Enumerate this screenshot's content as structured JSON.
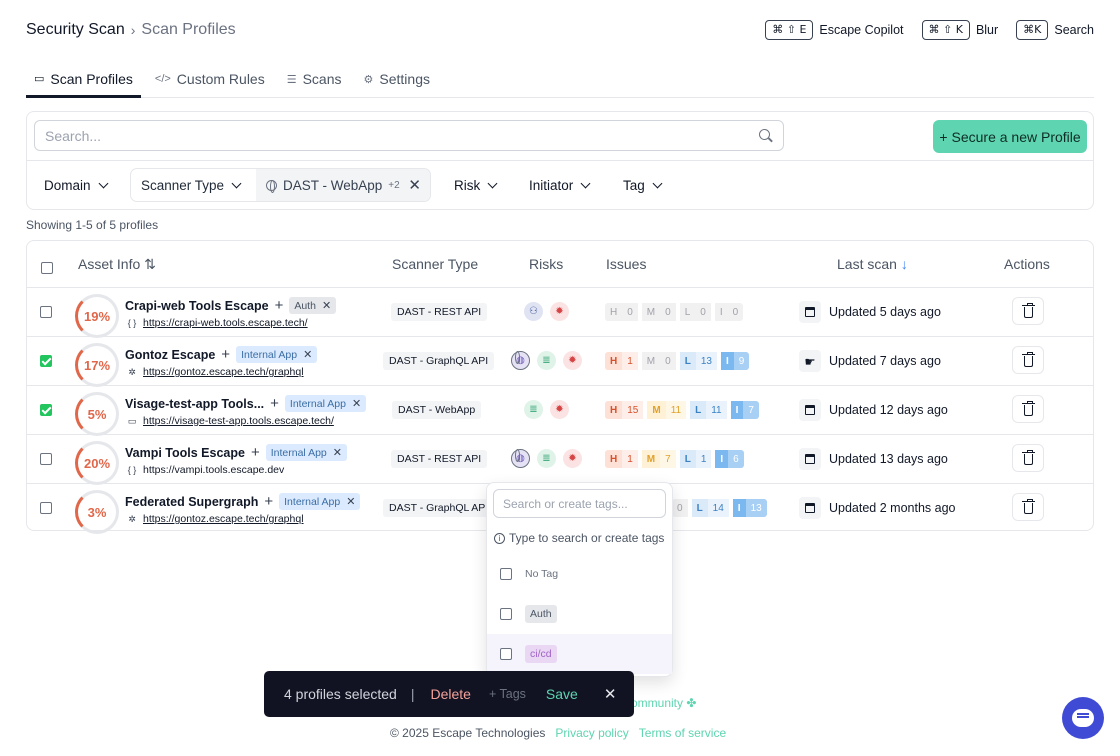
{
  "breadcrumb": {
    "root": "Security Scan",
    "separator": "›",
    "current": "Scan Profiles"
  },
  "shortcuts": [
    {
      "keys": "⌘ ⇧ E",
      "label": "Escape Copilot"
    },
    {
      "keys": "⌘ ⇧ K",
      "label": "Blur"
    },
    {
      "keys": "⌘K",
      "label": "Search"
    }
  ],
  "tabs": [
    {
      "label": "Scan Profiles",
      "icon": "layers-icon",
      "active": true
    },
    {
      "label": "Custom Rules",
      "icon": "code-icon",
      "active": false
    },
    {
      "label": "Scans",
      "icon": "list-icon",
      "active": false
    },
    {
      "label": "Settings",
      "icon": "gear-icon",
      "active": false
    }
  ],
  "search": {
    "placeholder": "Search...",
    "value": ""
  },
  "primary_button": {
    "label": "Secure a new Profile"
  },
  "filters": {
    "domain": "Domain",
    "scanner_type": "Scanner Type",
    "scanner_value": "DAST - WebApp",
    "scanner_more": "+2",
    "risk": "Risk",
    "initiator": "Initiator",
    "tag": "Tag"
  },
  "showing": "Showing 1-5 of 5 profiles",
  "table": {
    "headers": {
      "asset": "Asset Info",
      "scanner": "Scanner Type",
      "risks": "Risks",
      "issues": "Issues",
      "last_scan": "Last scan",
      "actions": "Actions"
    },
    "rows": [
      {
        "score": "19%",
        "name": "Crapi-web Tools Escape",
        "tag": "Auth",
        "tag_kind": "auth",
        "url": "https://crapi-web.tools.escape.tech/",
        "url_icon": "{ }",
        "scanner": "DAST - REST API",
        "checked": false,
        "issues": {
          "h": "0",
          "m": "0",
          "l": "0",
          "i": "0"
        },
        "last_scan": "Updated  5 days ago"
      },
      {
        "score": "17%",
        "name": "Gontoz Escape",
        "tag": "Internal App",
        "tag_kind": "internal",
        "url": "https://gontoz.escape.tech/graphql",
        "url_icon": "✲",
        "scanner": "DAST - GraphQL API",
        "checked": true,
        "issues": {
          "h": "1",
          "m": "0",
          "l": "13",
          "i": "9"
        },
        "last_scan": "Updated  7 days ago"
      },
      {
        "score": "5%",
        "name": "Visage-test-app Tools...",
        "tag": "Internal App",
        "tag_kind": "internal",
        "url": "https://visage-test-app.tools.escape.tech/",
        "url_icon": "▭",
        "scanner": "DAST - WebApp",
        "checked": true,
        "issues": {
          "h": "15",
          "m": "11",
          "l": "11",
          "i": "7"
        },
        "last_scan": "Updated  12 days ago"
      },
      {
        "score": "20%",
        "name": "Vampi Tools Escape",
        "tag": "Internal App",
        "tag_kind": "internal",
        "url": "https://vampi.tools.escape.dev",
        "url_icon": "{ }",
        "scanner": "DAST - REST API",
        "checked": false,
        "issues": {
          "h": "1",
          "m": "7",
          "l": "1",
          "i": "6"
        },
        "last_scan": "Updated  13 days ago"
      },
      {
        "score": "3%",
        "name": "Federated Supergraph",
        "tag": "Internal App",
        "tag_kind": "internal",
        "url": "https://gontoz.escape.tech/graphql",
        "url_icon": "✲",
        "scanner": "DAST - GraphQL API",
        "checked": false,
        "issues": {
          "h": "0",
          "m": "",
          "l": "14",
          "i": "13"
        },
        "last_scan": "Updated  2 months ago"
      }
    ]
  },
  "tag_dropdown": {
    "placeholder": "Search or create tags...",
    "hint": "Type to search or create tags",
    "items": [
      {
        "label": "No Tag"
      },
      {
        "label": "Auth"
      },
      {
        "label": "ci/cd"
      }
    ]
  },
  "selection_bar": {
    "count_text": "4 profiles selected",
    "divider": "|",
    "delete": "Delete",
    "tags": "+ Tags",
    "save": "Save",
    "close": "✕"
  },
  "footer": {
    "community": "ommunity ✤",
    "copyright": "© 2025 Escape Technologies",
    "privacy": "Privacy policy",
    "terms": "Terms of service"
  },
  "colors": {
    "accent": "#5ed4b0",
    "score": "#e0674a",
    "check": "#22c55e",
    "selection_bar": "#111322",
    "chat": "#3f4bd4"
  }
}
